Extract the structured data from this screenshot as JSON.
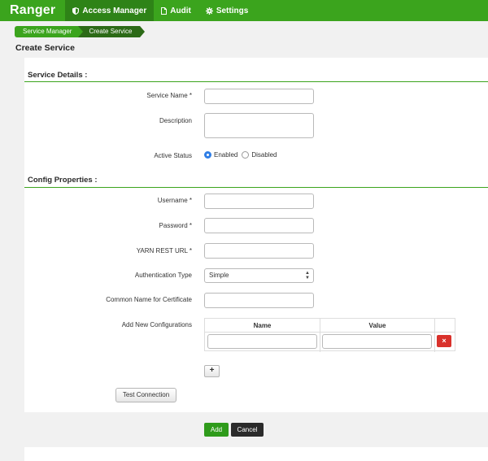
{
  "nav": {
    "brand": "Ranger",
    "items": [
      {
        "label": "Access Manager",
        "icon": "shield-icon",
        "active": true
      },
      {
        "label": "Audit",
        "icon": "document-icon",
        "active": false
      },
      {
        "label": "Settings",
        "icon": "gear-icon",
        "active": false
      }
    ]
  },
  "breadcrumb": [
    "Service Manager",
    "Create Service"
  ],
  "page_title": "Create Service",
  "service_details": {
    "title": "Service Details :",
    "service_name_label": "Service Name *",
    "description_label": "Description",
    "active_status_label": "Active Status",
    "enabled_label": "Enabled",
    "disabled_label": "Disabled",
    "selected": "Enabled"
  },
  "config": {
    "title": "Config Properties :",
    "username_label": "Username *",
    "password_label": "Password *",
    "yarn_url_label": "YARN REST URL *",
    "auth_type_label": "Authentication Type",
    "auth_type_value": "Simple",
    "common_name_label": "Common Name for Certificate",
    "add_configs_label": "Add New Configurations",
    "table_headers": [
      "Name",
      "Value"
    ]
  },
  "buttons": {
    "delete": "×",
    "plus": "+",
    "test_connection": "Test Connection",
    "add": "Add",
    "cancel": "Cancel"
  },
  "colors": {
    "nav_green": "#3ba41d",
    "nav_active": "#2e8317",
    "delete_red": "#d9312b",
    "add_green": "#2f9b1b",
    "cancel_dark": "#2b2b2b"
  }
}
